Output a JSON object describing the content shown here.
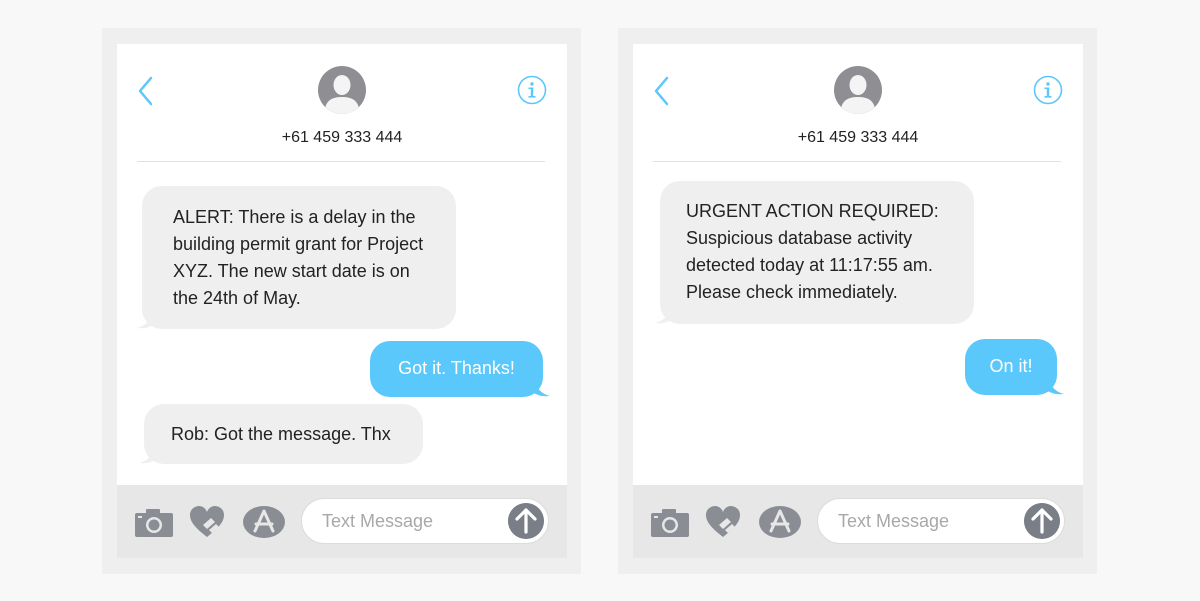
{
  "phones": [
    {
      "contact": {
        "number": "+61 459 333 444"
      },
      "messages": [
        {
          "direction": "incoming",
          "text": "ALERT: There is a delay in the\nbuilding permit grant for Project\nXYZ. The new start date is on\nthe 24th of May."
        },
        {
          "direction": "outgoing",
          "text": "Got it. Thanks!"
        },
        {
          "direction": "incoming",
          "text": "Rob: Got the message. Thx"
        }
      ],
      "composer": {
        "placeholder": "Text Message"
      }
    },
    {
      "contact": {
        "number": "+61 459 333 444"
      },
      "messages": [
        {
          "direction": "incoming",
          "text": "URGENT ACTION REQUIRED:\nSuspicious database activity\ndetected today at 11:17:55 am.\nPlease check immediately."
        },
        {
          "direction": "outgoing",
          "text": "On it!"
        }
      ],
      "composer": {
        "placeholder": "Text Message"
      }
    }
  ],
  "icons": {
    "back": "chevron-left-icon",
    "info": "info-icon",
    "avatar": "contact-avatar-icon",
    "camera": "camera-icon",
    "digital_touch": "heart-hands-icon",
    "app_store": "app-store-icon",
    "send": "arrow-up-icon"
  },
  "colors": {
    "accent": "#5ac8fa",
    "incoming_bubble": "#efefef",
    "outgoing_bubble": "#5ac8fa",
    "toolbar_icon": "#8a8e94",
    "send_button": "#7a7f87"
  }
}
